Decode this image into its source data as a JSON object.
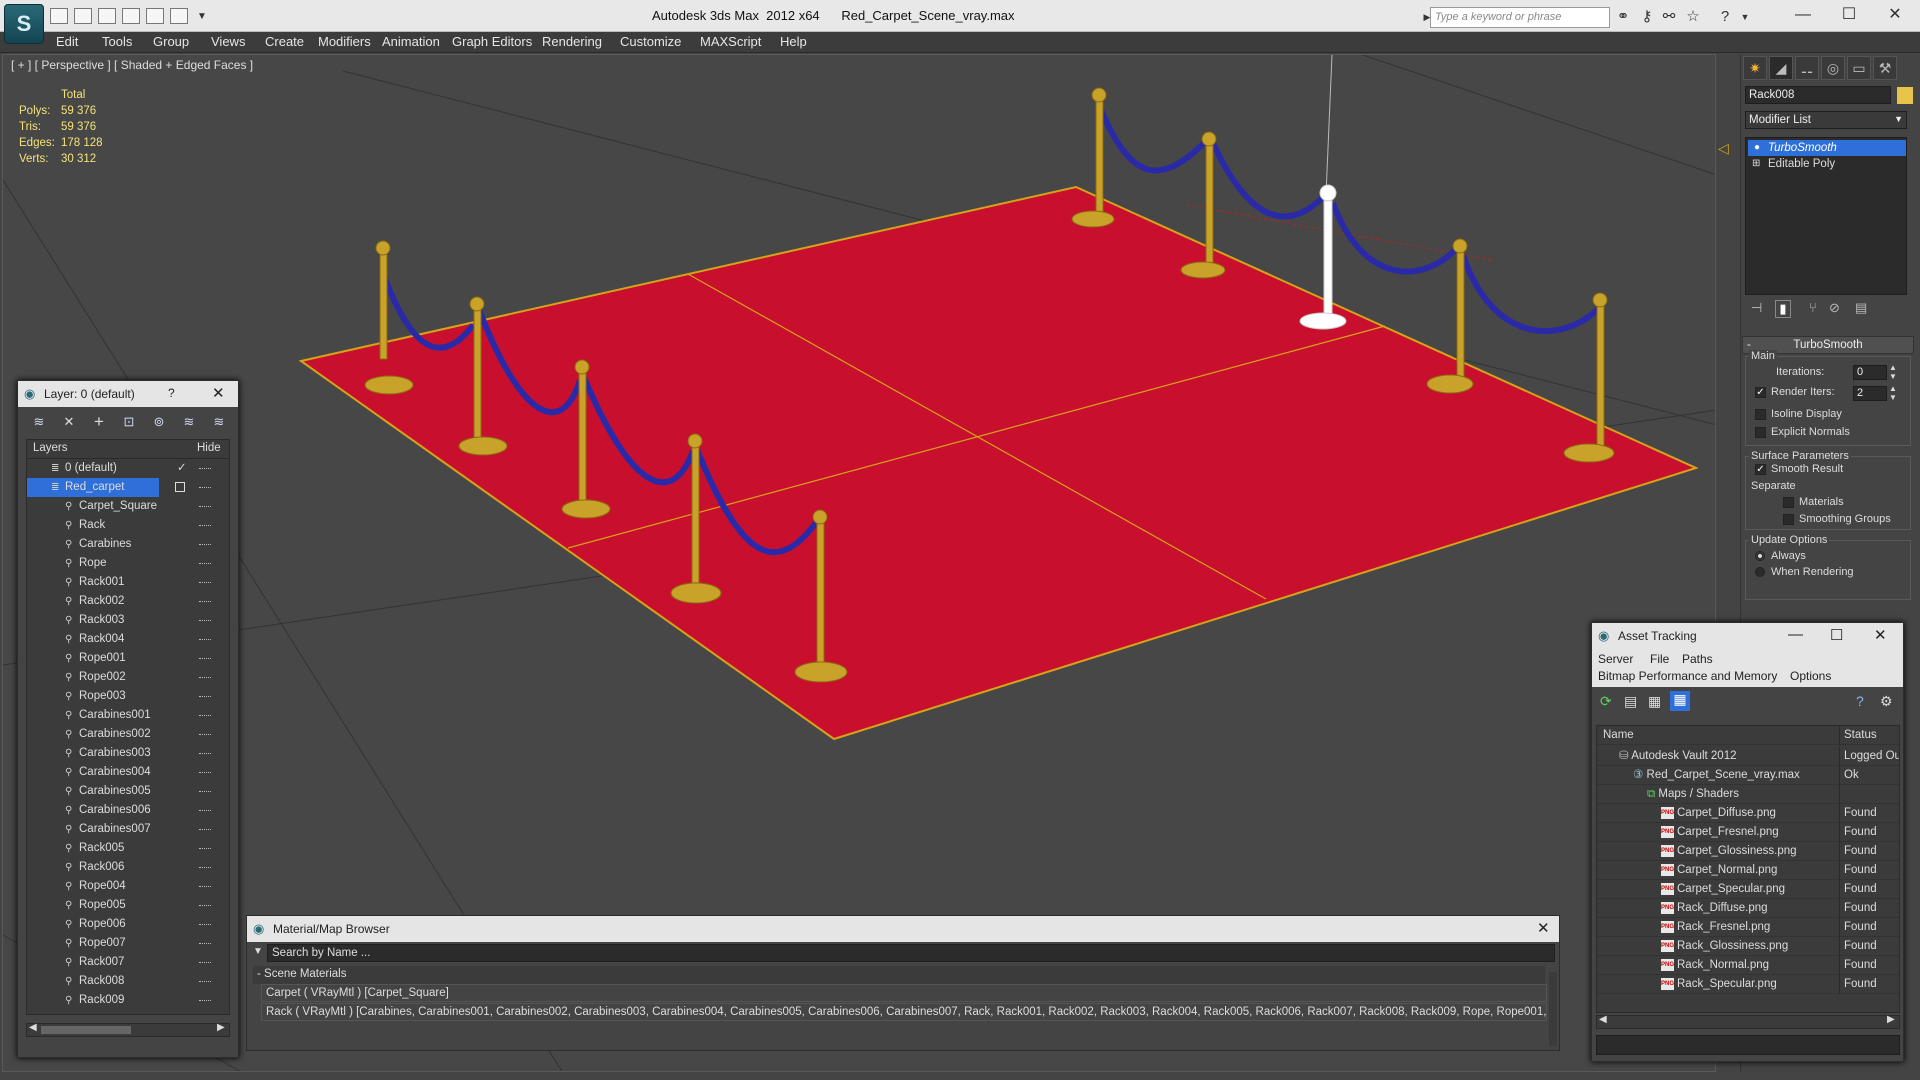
{
  "app": {
    "title": "Autodesk 3ds Max  2012 x64      Red_Carpet_Scene_vray.max",
    "logo": "3ds-max-logo",
    "search_placeholder": "Type a keyword or phrase"
  },
  "menu": [
    "Edit",
    "Tools",
    "Group",
    "Views",
    "Create",
    "Modifiers",
    "Animation",
    "Graph Editors",
    "Rendering",
    "Customize",
    "MAXScript",
    "Help"
  ],
  "viewport": {
    "label": "[ + ] [ Perspective ] [ Shaded + Edged Faces ]",
    "stats": {
      "header": "Total",
      "rows": [
        {
          "k": "Polys:",
          "v": "59 376"
        },
        {
          "k": "Tris:",
          "v": "59 376"
        },
        {
          "k": "Edges:",
          "v": "178 128"
        },
        {
          "k": "Verts:",
          "v": "30 312"
        }
      ]
    }
  },
  "command_panel": {
    "object_name": "Rack008",
    "modifier_list": "Modifier List",
    "stack": [
      "TurboSmooth",
      "Editable Poly"
    ],
    "rollout_title": "TurboSmooth",
    "main_label": "Main",
    "iterations_label": "Iterations:",
    "iterations_value": "0",
    "render_iters_label": "Render Iters:",
    "render_iters_value": "2",
    "isoline_label": "Isoline Display",
    "explicit_normals_label": "Explicit Normals",
    "surface_params_label": "Surface Parameters",
    "smooth_result_label": "Smooth Result",
    "separate_label": "Separate",
    "materials_label": "Materials",
    "smoothing_groups_label": "Smoothing Groups",
    "update_options_label": "Update Options",
    "always_label": "Always",
    "when_rendering_label": "When Rendering",
    "accent": "#2e6fd9"
  },
  "layer_dialog": {
    "title": "Layer: 0 (default)",
    "help": "?",
    "col_layers": "Layers",
    "col_hide": "Hide",
    "rows": [
      {
        "name": "0 (default)",
        "indent": 0,
        "type": "layer"
      },
      {
        "name": "Red_carpet",
        "indent": 0,
        "type": "layer"
      },
      {
        "name": "Carpet_Square",
        "indent": 1,
        "type": "object"
      },
      {
        "name": "Rack",
        "indent": 1,
        "type": "object"
      },
      {
        "name": "Carabines",
        "indent": 1,
        "type": "object"
      },
      {
        "name": "Rope",
        "indent": 1,
        "type": "object"
      },
      {
        "name": "Rack001",
        "indent": 1,
        "type": "object"
      },
      {
        "name": "Rack002",
        "indent": 1,
        "type": "object"
      },
      {
        "name": "Rack003",
        "indent": 1,
        "type": "object"
      },
      {
        "name": "Rack004",
        "indent": 1,
        "type": "object"
      },
      {
        "name": "Rope001",
        "indent": 1,
        "type": "object"
      },
      {
        "name": "Rope002",
        "indent": 1,
        "type": "object"
      },
      {
        "name": "Rope003",
        "indent": 1,
        "type": "object"
      },
      {
        "name": "Carabines001",
        "indent": 1,
        "type": "object"
      },
      {
        "name": "Carabines002",
        "indent": 1,
        "type": "object"
      },
      {
        "name": "Carabines003",
        "indent": 1,
        "type": "object"
      },
      {
        "name": "Carabines004",
        "indent": 1,
        "type": "object"
      },
      {
        "name": "Carabines005",
        "indent": 1,
        "type": "object"
      },
      {
        "name": "Carabines006",
        "indent": 1,
        "type": "object"
      },
      {
        "name": "Carabines007",
        "indent": 1,
        "type": "object"
      },
      {
        "name": "Rack005",
        "indent": 1,
        "type": "object"
      },
      {
        "name": "Rack006",
        "indent": 1,
        "type": "object"
      },
      {
        "name": "Rope004",
        "indent": 1,
        "type": "object"
      },
      {
        "name": "Rope005",
        "indent": 1,
        "type": "object"
      },
      {
        "name": "Rope006",
        "indent": 1,
        "type": "object"
      },
      {
        "name": "Rope007",
        "indent": 1,
        "type": "object"
      },
      {
        "name": "Rack007",
        "indent": 1,
        "type": "object"
      },
      {
        "name": "Rack008",
        "indent": 1,
        "type": "object"
      },
      {
        "name": "Rack009",
        "indent": 1,
        "type": "object"
      }
    ]
  },
  "material_browser": {
    "title": "Material/Map Browser",
    "search_placeholder": "Search by Name ...",
    "group": "- Scene Materials",
    "items": [
      "Carpet  ( VRayMtl )  [Carpet_Square]",
      "Rack  ( VRayMtl )  [Carabines, Carabines001, Carabines002, Carabines003, Carabines004, Carabines005, Carabines006, Carabines007, Rack, Rack001, Rack002, Rack003, Rack004, Rack005, Rack006, Rack007, Rack008, Rack009, Rope, Rope001, Rope..."
    ]
  },
  "asset_tracking": {
    "title": "Asset Tracking",
    "menu": [
      "Server",
      "File",
      "Paths"
    ],
    "menu2": [
      "Bitmap Performance and Memory",
      "Options"
    ],
    "col_name": "Name",
    "col_status": "Status",
    "rows": [
      {
        "name": "Autodesk Vault 2012",
        "status": "Logged Ou",
        "indent": 1,
        "icon": "vault-icon"
      },
      {
        "name": "Red_Carpet_Scene_vray.max",
        "status": "Ok",
        "indent": 2,
        "icon": "max-file-icon"
      },
      {
        "name": "Maps / Shaders",
        "status": "",
        "indent": 3,
        "icon": "maps-folder-icon"
      },
      {
        "name": "Carpet_Diffuse.png",
        "status": "Found",
        "indent": 4,
        "icon": "png-icon"
      },
      {
        "name": "Carpet_Fresnel.png",
        "status": "Found",
        "indent": 4,
        "icon": "png-icon"
      },
      {
        "name": "Carpet_Glossiness.png",
        "status": "Found",
        "indent": 4,
        "icon": "png-icon"
      },
      {
        "name": "Carpet_Normal.png",
        "status": "Found",
        "indent": 4,
        "icon": "png-icon"
      },
      {
        "name": "Carpet_Specular.png",
        "status": "Found",
        "indent": 4,
        "icon": "png-icon"
      },
      {
        "name": "Rack_Diffuse.png",
        "status": "Found",
        "indent": 4,
        "icon": "png-icon"
      },
      {
        "name": "Rack_Fresnel.png",
        "status": "Found",
        "indent": 4,
        "icon": "png-icon"
      },
      {
        "name": "Rack_Glossiness.png",
        "status": "Found",
        "indent": 4,
        "icon": "png-icon"
      },
      {
        "name": "Rack_Normal.png",
        "status": "Found",
        "indent": 4,
        "icon": "png-icon"
      },
      {
        "name": "Rack_Specular.png",
        "status": "Found",
        "indent": 4,
        "icon": "png-icon"
      }
    ]
  },
  "colors": {
    "carpet": "#c8102e",
    "carpet_edge": "#d6a318",
    "rope": "#2a2aa8",
    "post": "#c9a22a",
    "selection": "#2e6fd9"
  }
}
